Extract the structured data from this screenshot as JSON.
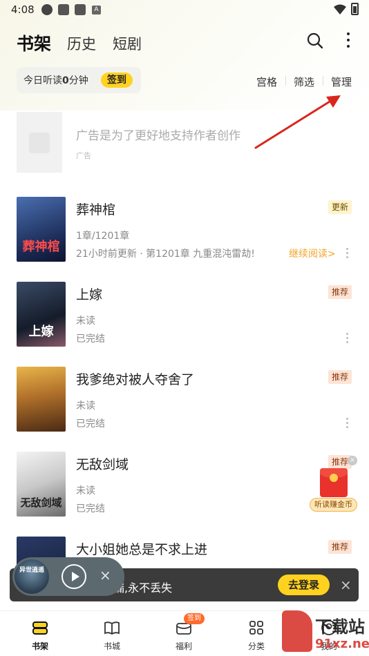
{
  "status_bar": {
    "time": "4:08",
    "badge_letter": "A"
  },
  "header": {
    "tabs": [
      {
        "label": "书架",
        "active": true
      },
      {
        "label": "历史",
        "active": false
      },
      {
        "label": "短剧",
        "active": false
      }
    ],
    "search_icon": "search-icon",
    "more_icon": "more-vertical-icon"
  },
  "toolbar": {
    "listen_prefix": "今日听读",
    "listen_minutes": "0",
    "listen_suffix": "分钟",
    "signin_label": "签到",
    "grid_label": "宫格",
    "filter_label": "筛选",
    "manage_label": "管理"
  },
  "ad": {
    "title": "广告是为了更好地支持作者创作",
    "tag": "广告"
  },
  "books": [
    {
      "title": "葬神棺",
      "badge": "更新",
      "line1": "1章/1201章",
      "line2": "21小时前更新 · 第1201章 九重混沌雷劫!",
      "action": "继续阅读>",
      "cover_text": "葬神棺",
      "cover_color": "#2a3f72"
    },
    {
      "title": "上嫁",
      "badge": "推荐",
      "line1": "未读",
      "line2": "已完结",
      "cover_text": "上嫁",
      "cover_color": "#1f2b3a"
    },
    {
      "title": "我爹绝对被人夺舍了",
      "badge": "推荐",
      "line1": "未读",
      "line2": "已完结",
      "cover_text": "",
      "cover_color": "#8a5a1e"
    },
    {
      "title": "无敌剑域",
      "badge": "推荐",
      "line1": "未读",
      "line2": "已完结",
      "cover_text": "无敌剑域",
      "cover_color": "#d9d9d9"
    },
    {
      "title": "大小姐她总是不求上进",
      "badge": "推荐",
      "line1": "",
      "line2": "",
      "cover_text": "",
      "cover_color": "#1e2a4a"
    }
  ],
  "floating": {
    "redpacket_label": "听读赚金币",
    "close_label": "×"
  },
  "login_banner": {
    "text": "漏,永不丢失",
    "button_label": "去登录",
    "close_label": "×"
  },
  "mini_player": {
    "cover_text": "异世逍遥",
    "close_label": "×"
  },
  "bottom_nav": {
    "items": [
      {
        "label": "书架",
        "icon": "bookshelf-icon"
      },
      {
        "label": "书城",
        "icon": "book-open-icon"
      },
      {
        "label": "福利",
        "icon": "gift-icon",
        "badge": "签到"
      },
      {
        "label": "分类",
        "icon": "category-grid-icon"
      },
      {
        "label": "我的",
        "icon": "profile-icon"
      }
    ]
  },
  "watermark": {
    "line1": "下载站",
    "line2": "91xz.net"
  },
  "colors": {
    "accent_yellow": "#ffd21f",
    "continue_orange": "#f0a52a",
    "annotation_red": "#d9261c"
  }
}
